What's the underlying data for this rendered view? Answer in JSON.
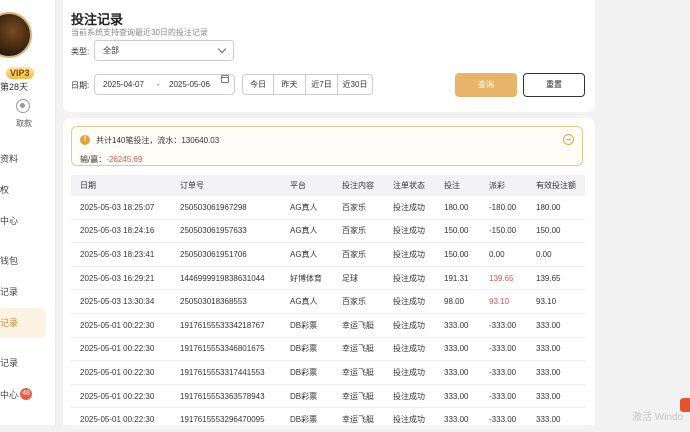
{
  "sidebar": {
    "vip": "VIP3",
    "days": "第28天",
    "withdraw_label": "取款",
    "items": [
      {
        "label": "资料"
      },
      {
        "label": "权"
      },
      {
        "label": "中心"
      },
      {
        "label": "钱包"
      },
      {
        "label": "记录"
      },
      {
        "label": "记录"
      },
      {
        "label": "记录"
      },
      {
        "label": "中心",
        "badge": "48"
      }
    ]
  },
  "filter": {
    "title": "投注记录",
    "subtitle": "当前系统支持查询最近30日的投注记录",
    "type_label": "类型:",
    "type_value": "全部",
    "date_label": "日期:",
    "date_start": "2025-04-07",
    "date_sep": "-",
    "date_end": "2025-05-06",
    "quick": [
      "今日",
      "昨天",
      "近7日",
      "近30日"
    ],
    "query_label": "查询",
    "reset_label": "重置"
  },
  "summary": {
    "line1": "共计140笔投注，流水：130640.03",
    "line2_label": "输/赢：",
    "line2_value": "-26245.69"
  },
  "table": {
    "headers": [
      "日期",
      "订单号",
      "平台",
      "投注内容",
      "注单状态",
      "投注",
      "派彩",
      "有效投注额"
    ],
    "rows": [
      [
        "2025-05-03 18:25:07",
        "250503061967298",
        "AG真人",
        "百家乐",
        "投注成功",
        "180.00",
        "-180.00",
        "180.00"
      ],
      [
        "2025-05-03 18:24:16",
        "250503061957633",
        "AG真人",
        "百家乐",
        "投注成功",
        "150.00",
        "-150.00",
        "150.00"
      ],
      [
        "2025-05-03 18:23:41",
        "250503061951706",
        "AG真人",
        "百家乐",
        "投注成功",
        "150.00",
        "0.00",
        "0.00"
      ],
      [
        "2025-05-03 16:29:21",
        "1446999919838631044",
        "好博体育",
        "足球",
        "投注成功",
        "191.31",
        "139.65",
        "139.65"
      ],
      [
        "2025-05-03 13:30:34",
        "250503018368553",
        "AG真人",
        "百家乐",
        "投注成功",
        "98.00",
        "93.10",
        "93.10"
      ],
      [
        "2025-05-01 00:22:30",
        "1917615553334218767",
        "DB彩票",
        "幸运飞艇",
        "投注成功",
        "333.00",
        "-333.00",
        "333.00"
      ],
      [
        "2025-05-01 00:22:30",
        "1917615553346801675",
        "DB彩票",
        "幸运飞艇",
        "投注成功",
        "333.00",
        "-333.00",
        "333.00"
      ],
      [
        "2025-05-01 00:22:30",
        "1917615553317441553",
        "DB彩票",
        "幸运飞艇",
        "投注成功",
        "333.00",
        "-333.00",
        "333.00"
      ],
      [
        "2025-05-01 00:22:30",
        "1917615553363578943",
        "DB彩票",
        "幸运飞艇",
        "投注成功",
        "333.00",
        "-333.00",
        "333.00"
      ],
      [
        "2025-05-01 00:22:30",
        "1917615553296470095",
        "DB彩票",
        "幸运飞艇",
        "投注成功",
        "333.00",
        "-333.00",
        "333.00"
      ]
    ],
    "positive_payout_rows": [
      3,
      4
    ]
  },
  "watermark": "激活 Windo",
  "colors": {
    "accent": "#e8b46a",
    "negative": "#d9534f",
    "active_bg": "#fdf3e3"
  }
}
